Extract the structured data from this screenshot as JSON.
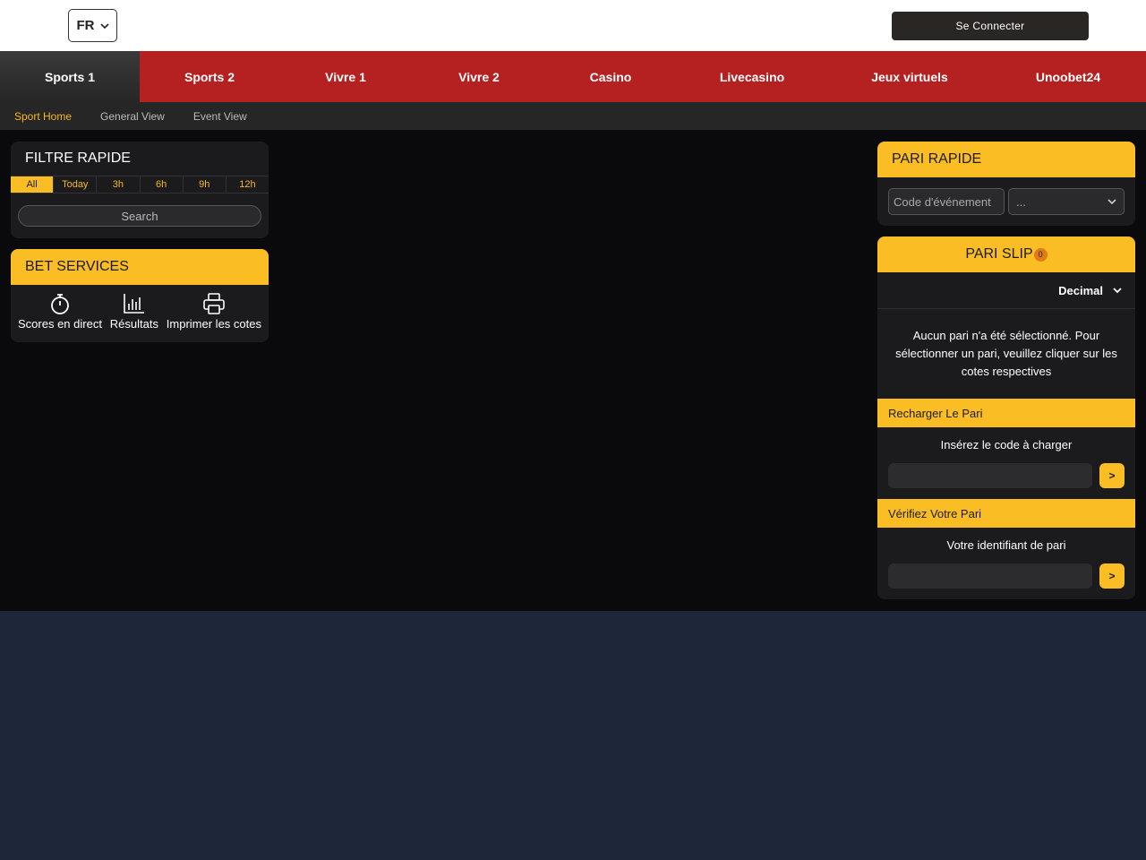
{
  "header": {
    "language": "FR",
    "login_label": "Se Connecter"
  },
  "main_nav": [
    {
      "label": "Sports 1",
      "active": true
    },
    {
      "label": "Sports 2"
    },
    {
      "label": "Vivre 1"
    },
    {
      "label": "Vivre 2"
    },
    {
      "label": "Casino"
    },
    {
      "label": "Livecasino"
    },
    {
      "label": "Jeux virtuels"
    },
    {
      "label": "Unoobet24"
    }
  ],
  "sub_nav": [
    {
      "label": "Sport Home",
      "active": true
    },
    {
      "label": "General View"
    },
    {
      "label": "Event View"
    }
  ],
  "filtre": {
    "title": "FILTRE RAPIDE",
    "tabs": [
      "All",
      "Today",
      "3h",
      "6h",
      "9h",
      "12h"
    ],
    "search_label": "Search"
  },
  "bet_services": {
    "title": "BET SERVICES",
    "items": [
      {
        "label": "Scores en direct",
        "icon": "stopwatch-icon"
      },
      {
        "label": "Résultats",
        "icon": "bar-chart-icon"
      },
      {
        "label": "Imprimer les cotes",
        "icon": "printer-icon"
      }
    ]
  },
  "pari_rapide": {
    "title": "PARI RAPIDE",
    "code_placeholder": "Code d'événement",
    "select_value": "..."
  },
  "pari_slip": {
    "title": "PARI SLIP",
    "count": "0",
    "odds_format": "Decimal",
    "empty_message": "Aucun pari n'a été sélectionné. Pour sélectionner un pari, veuillez cliquer sur les cotes respectives",
    "reload": {
      "title": "Recharger Le Pari",
      "label": "Insérez le code à charger",
      "button": ">"
    },
    "verify": {
      "title": "Vérifiez Votre Pari",
      "label": "Votre identifiant de pari",
      "button": ">"
    }
  },
  "colors": {
    "accent": "#fbbd24",
    "nav_red": "#b52020",
    "footer_bg": "#1e2639"
  }
}
